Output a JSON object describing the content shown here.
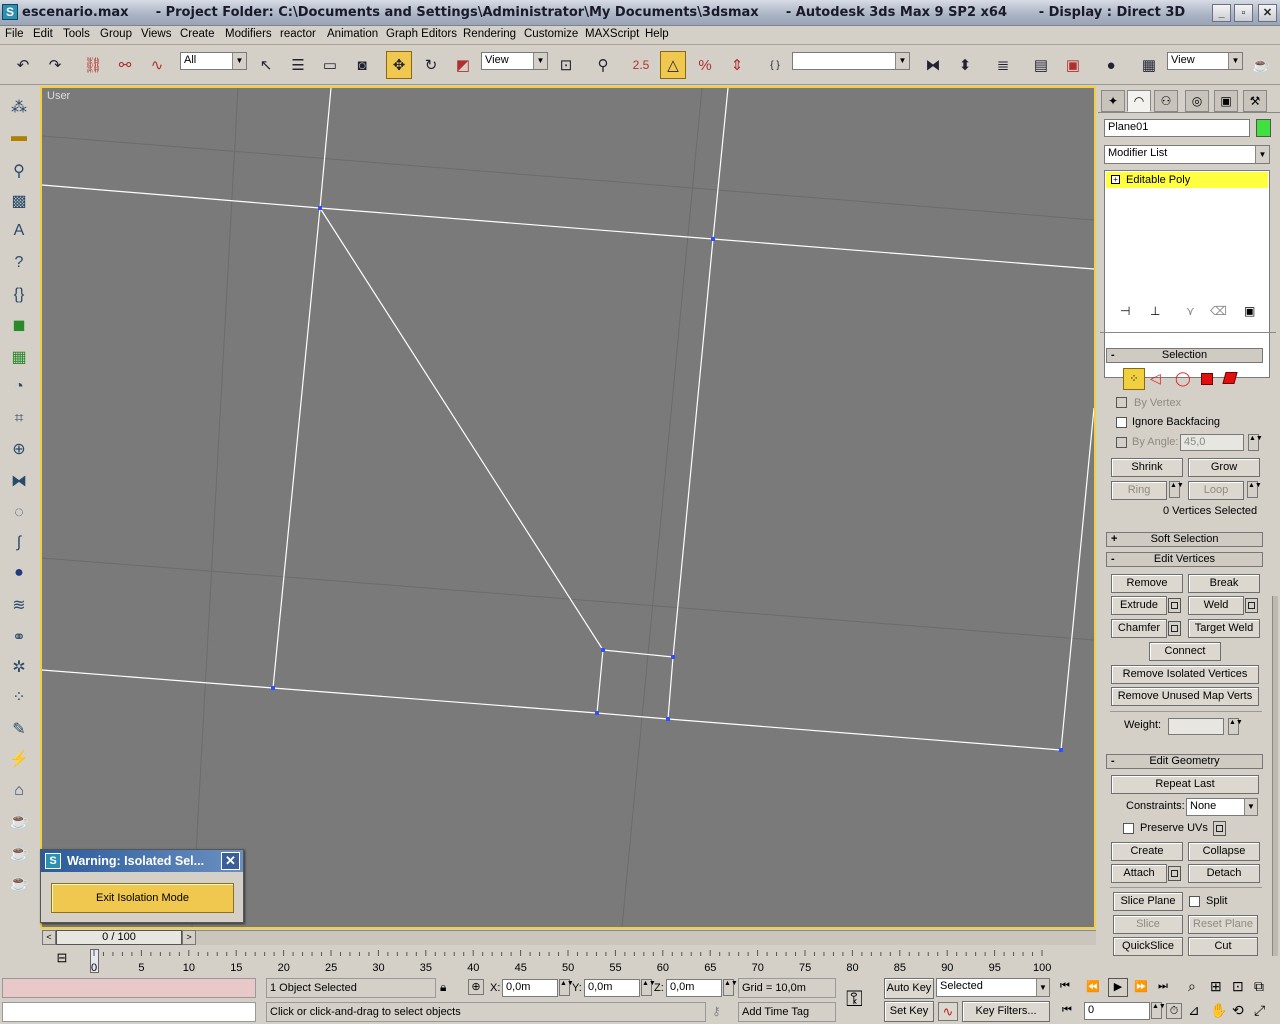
{
  "titlebar": {
    "title": "escenario.max      - Project Folder: C:\\Documents and Settings\\Administrator\\My Documents\\3dsmax      - Autodesk 3ds Max 9 SP2 x64       - Display : Direct 3D",
    "minimize": "_",
    "maximize": "▫",
    "close": "✕"
  },
  "menu": [
    "File",
    "Edit",
    "Tools",
    "Group",
    "Views",
    "Create",
    "Modifiers",
    "reactor",
    "Animation",
    "Graph Editors",
    "Rendering",
    "Customize",
    "MAXScript",
    "Help"
  ],
  "toolbar": {
    "selection_filter": "All",
    "ref_coord": "View",
    "snap_label": "2.5",
    "percent_label": "%",
    "named_sel": "",
    "render_view": "View"
  },
  "viewport": {
    "label": "User"
  },
  "command_panel": {
    "object_name": "Plane01",
    "object_color": "#40e040",
    "modifier_list": "Modifier List",
    "stack_item": "Editable Poly",
    "selection": {
      "title": "Selection",
      "by_vertex": "By Vertex",
      "ignore_backfacing": "Ignore Backfacing",
      "by_angle": "By Angle:",
      "angle_value": "45,0",
      "shrink": "Shrink",
      "grow": "Grow",
      "ring": "Ring",
      "loop": "Loop",
      "status": "0 Vertices Selected"
    },
    "soft_selection": "Soft Selection",
    "edit_vertices": {
      "title": "Edit Vertices",
      "remove": "Remove",
      "break": "Break",
      "extrude": "Extrude",
      "weld": "Weld",
      "chamfer": "Chamfer",
      "target_weld": "Target Weld",
      "connect": "Connect",
      "remove_isolated": "Remove Isolated Vertices",
      "remove_unused": "Remove Unused Map Verts",
      "weight": "Weight:"
    },
    "edit_geometry": {
      "title": "Edit Geometry",
      "repeat_last": "Repeat Last",
      "constraints": "Constraints:",
      "constraints_value": "None",
      "preserve_uvs": "Preserve UVs",
      "create": "Create",
      "collapse": "Collapse",
      "attach": "Attach",
      "detach": "Detach",
      "slice_plane": "Slice Plane",
      "split": "Split",
      "slice": "Slice",
      "reset_plane": "Reset Plane",
      "quickslice": "QuickSlice",
      "cut": "Cut"
    }
  },
  "warning": {
    "title": "Warning: Isolated Sel...",
    "button": "Exit Isolation Mode"
  },
  "timeslider": {
    "label": "0 / 100",
    "current_frame": 0,
    "total_frames": 100
  },
  "trackbar": {
    "ticks": [
      "0",
      "5",
      "10",
      "15",
      "20",
      "25",
      "30",
      "35",
      "40",
      "45",
      "50",
      "55",
      "60",
      "65",
      "70",
      "75",
      "80",
      "85",
      "90",
      "95",
      "100"
    ]
  },
  "status": {
    "selected": "1 Object Selected",
    "prompt": "Click or click-and-drag to select objects",
    "x_label": "X:",
    "x": "0,0m",
    "y_label": "Y:",
    "y": "0,0m",
    "z_label": "Z:",
    "z": "0,0m",
    "grid": "Grid = 10,0m",
    "add_time_tag": "Add Time Tag"
  },
  "anim": {
    "auto_key": "Auto Key",
    "set_key": "Set Key",
    "selected_value": "Selected",
    "key_filters": "Key Filters...",
    "frame": "0"
  }
}
